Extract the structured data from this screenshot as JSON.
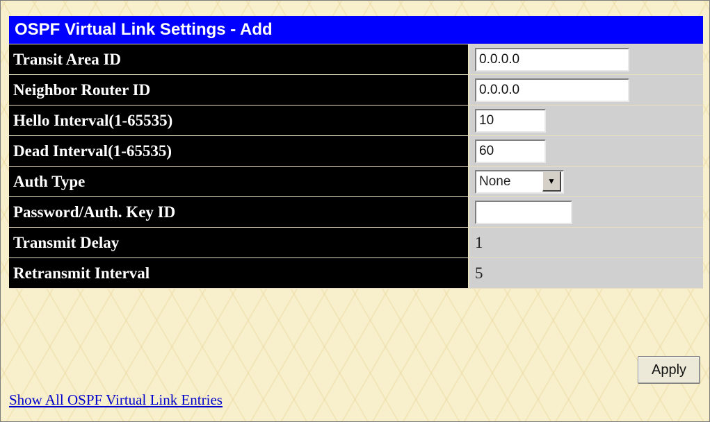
{
  "title": "OSPF Virtual Link Settings - Add",
  "fields": {
    "transit_area_id": {
      "label": "Transit Area ID",
      "value": "0.0.0.0"
    },
    "neighbor_router_id": {
      "label": "Neighbor Router ID",
      "value": "0.0.0.0"
    },
    "hello_interval": {
      "label": "Hello Interval(1-65535)",
      "value": "10"
    },
    "dead_interval": {
      "label": "Dead Interval(1-65535)",
      "value": "60"
    },
    "auth_type": {
      "label": "Auth Type",
      "value": "None"
    },
    "password": {
      "label": "Password/Auth. Key ID",
      "value": ""
    },
    "transmit_delay": {
      "label": "Transmit Delay",
      "value": "1"
    },
    "retransmit_interval": {
      "label": "Retransmit Interval",
      "value": "5"
    }
  },
  "apply_label": "Apply",
  "link_text": "Show All OSPF Virtual Link Entries"
}
